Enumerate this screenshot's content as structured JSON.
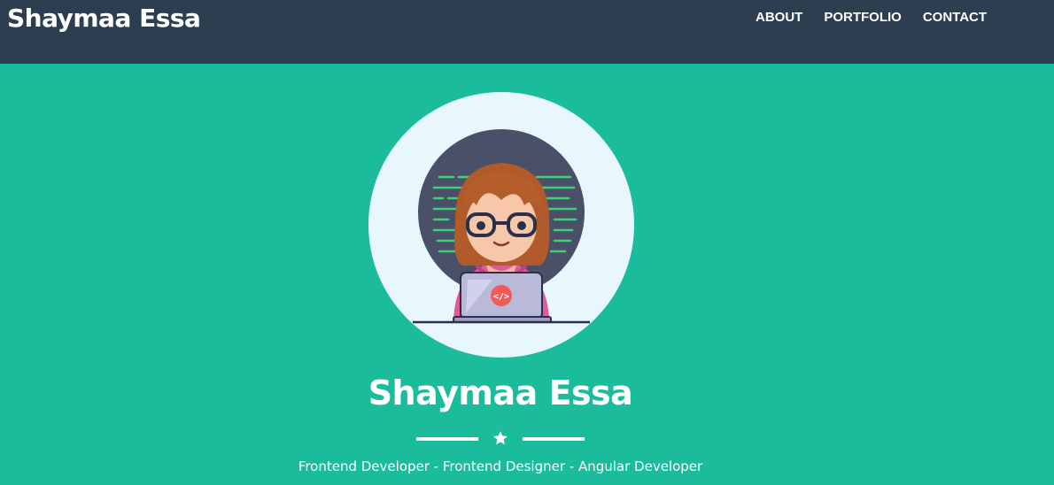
{
  "navbar": {
    "brand": "Shaymaa Essa",
    "links": [
      "ABOUT",
      "PORTFOLIO",
      "CONTACT"
    ]
  },
  "hero": {
    "name": "Shaymaa Essa",
    "subtitle": "Frontend Developer - Frontend Designer - Angular Developer",
    "divider_icon": "star-icon",
    "laptop_badge": "</>"
  },
  "colors": {
    "navbar_bg": "#2c3e50",
    "hero_bg": "#1abc9c",
    "avatar_bg": "#e7f7fd",
    "text": "#ffffff"
  }
}
